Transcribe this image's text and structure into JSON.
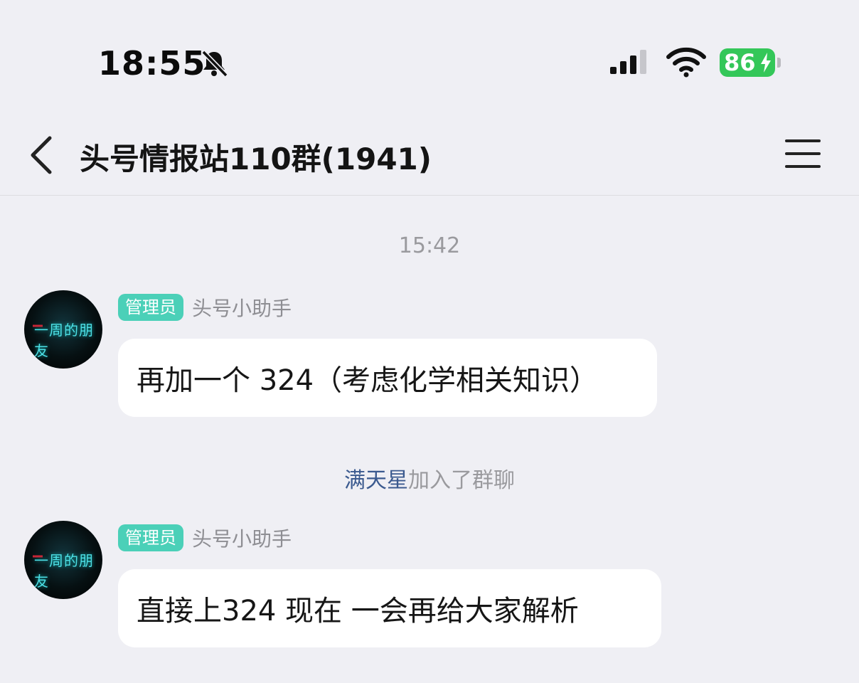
{
  "status_bar": {
    "time": "18:55",
    "battery": "86",
    "icons": [
      "bell-slash-icon",
      "cellular-signal-icon",
      "wifi-icon",
      "battery-charging-icon"
    ]
  },
  "header": {
    "title": "头号情报站110群(1941)",
    "back_icon": "chevron-left-icon",
    "menu_icon": "hamburger-menu-icon"
  },
  "chat": {
    "timestamp": "15:42",
    "messages": [
      {
        "role": "管理员",
        "sender": "头号小助手",
        "avatar_text": "一周的朋友",
        "text": "再加一个 324（考虑化学相关知识）"
      },
      {
        "role": "管理员",
        "sender": "头号小助手",
        "avatar_text": "一周的朋友",
        "text": "直接上324 现在 一会再给大家解析"
      }
    ],
    "system_message": {
      "user": "满天星",
      "action": "加入了群聊"
    }
  },
  "colors": {
    "background": "#efeff4",
    "badge": "#4bd0b8",
    "bubble": "#ffffff",
    "battery": "#34c759",
    "system_user": "#3b5a8f"
  }
}
